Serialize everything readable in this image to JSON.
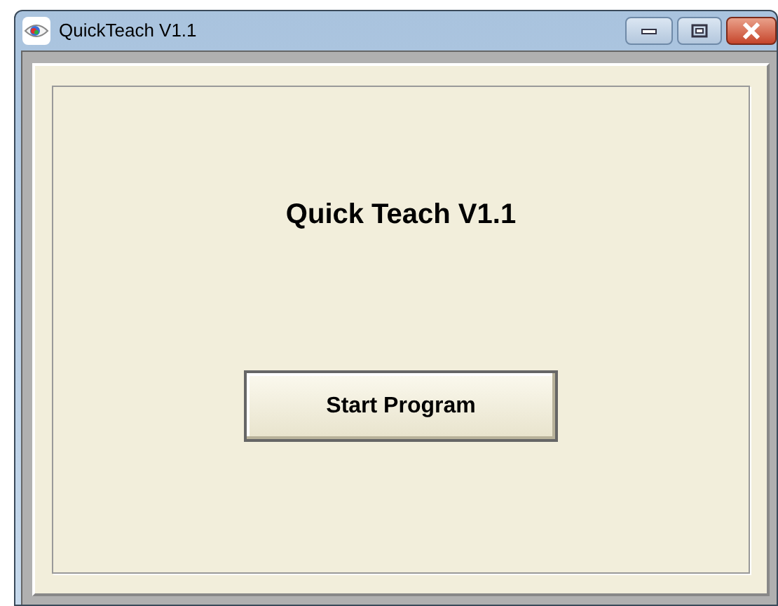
{
  "window": {
    "title": "QuickTeach V1.1"
  },
  "heading": "Quick Teach V1.1",
  "buttons": [
    {
      "label": "Start Program"
    }
  ]
}
